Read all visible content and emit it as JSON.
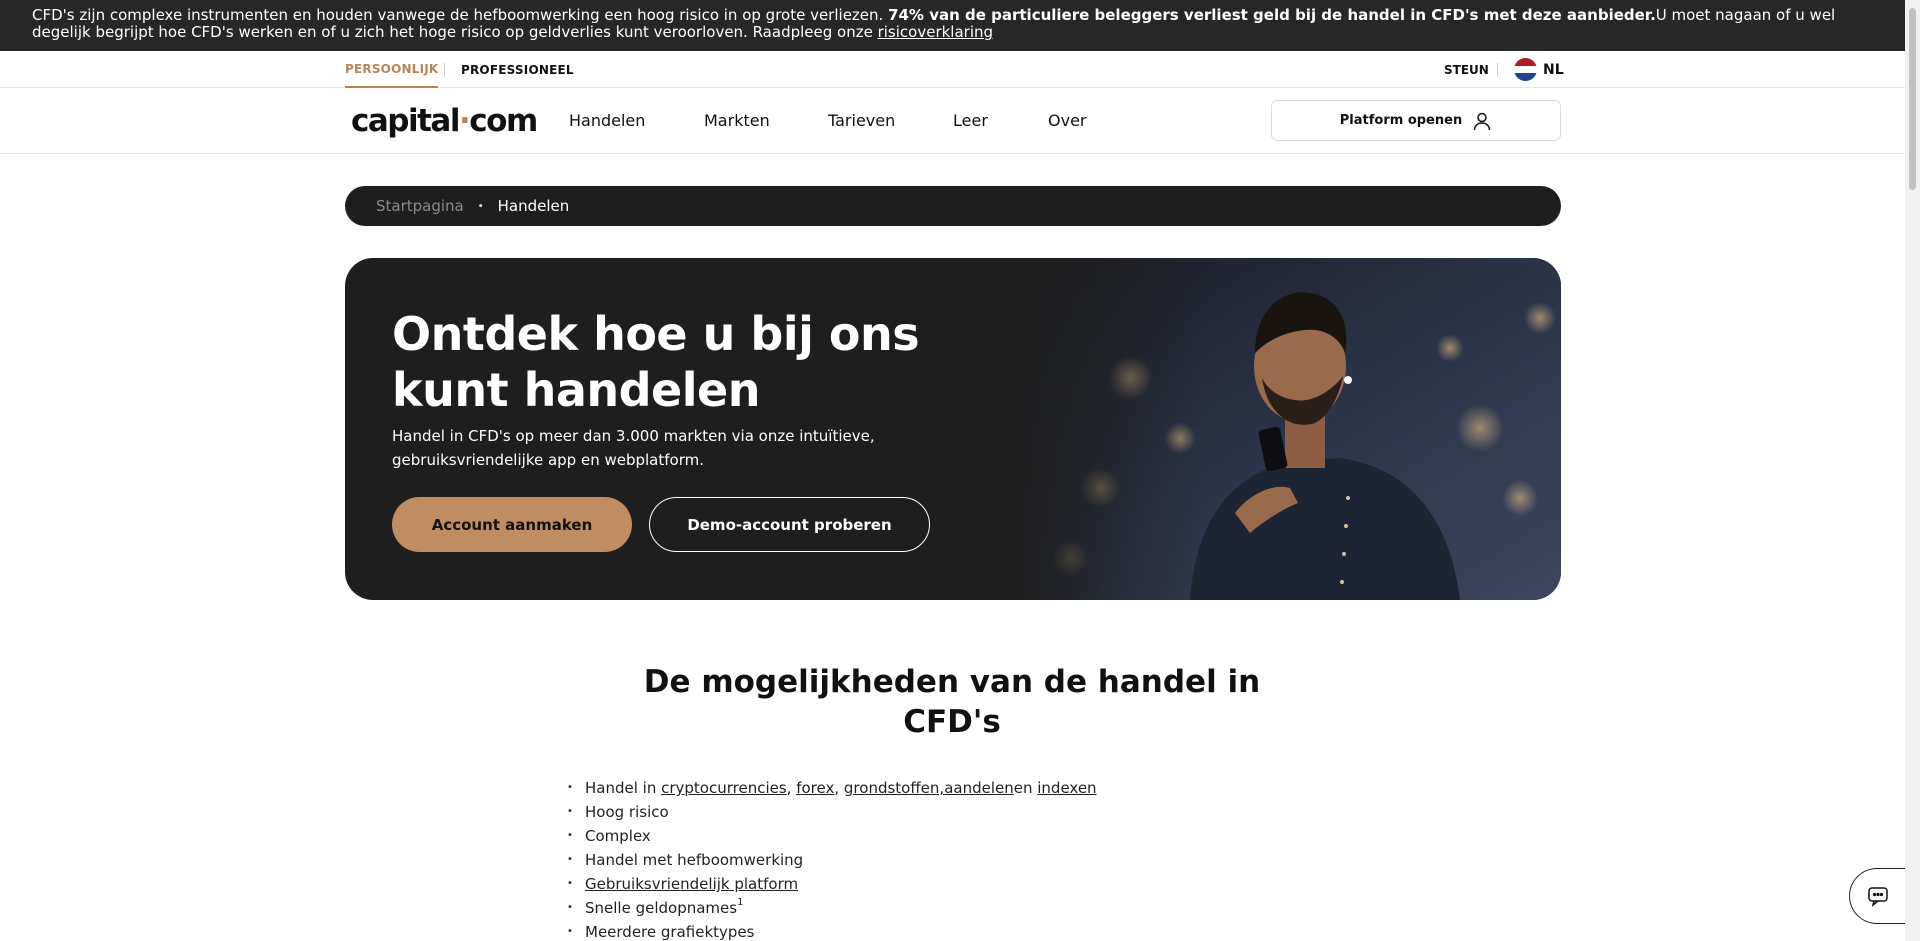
{
  "risk_banner": {
    "text_start": "CFD's zijn complexe instrumenten en houden vanwege de hefboomwerking een hoog risico in op grote verliezen. ",
    "text_bold": "74% van de particuliere beleggers verliest geld bij de handel in CFD's met deze aanbieder.",
    "text_end": "U moet nagaan of u wel degelijk begrijpt hoe CFD's werken en of u zich het hoge risico op geldverlies kunt veroorloven. Raadpleeg onze ",
    "link": "risicoverklaring"
  },
  "segments": {
    "personal": "PERSOONLIJK",
    "professional": "PROFESSIONEEL"
  },
  "support": "STEUN",
  "language": {
    "code": "NL",
    "flag_colors": [
      "#ae1c28",
      "#ffffff",
      "#21468b"
    ]
  },
  "logo": {
    "part1": "capital",
    "dot": "·",
    "part2": "com"
  },
  "nav": {
    "items": [
      "Handelen",
      "Markten",
      "Tarieven",
      "Leer",
      "Over"
    ],
    "platform_button": "Platform openen"
  },
  "breadcrumb": {
    "home": "Startpagina",
    "separator": "•",
    "current": "Handelen"
  },
  "hero": {
    "title": "Ontdek hoe u bij ons kunt handelen",
    "subtitle": "Handel in CFD's op meer dan 3.000 markten via onze intuïtieve, gebruiksvriendelijke app en webplatform.",
    "primary_button": "Account aanmaken",
    "secondary_button": "Demo-account proberen"
  },
  "section": {
    "title": "De mogelijkheden van de handel in CFD's"
  },
  "features": {
    "bullet": "•",
    "trade_prefix": "Handel in ",
    "crypto": "cryptocurrencies",
    "comma1": ", ",
    "forex": "forex",
    "comma2": ", ",
    "commodities": "grondstoffen,",
    "shares": "aandelen",
    "en": "en ",
    "indices": "indexen",
    "high_risk": "Hoog risico",
    "complex": "Complex",
    "leverage": "Handel met hefboomwerking",
    "platform": "Gebruiksvriendelijk platform",
    "withdrawals": "Snelle geldopnames",
    "footnote": "1",
    "chart_types": "Meerdere grafiektypes"
  },
  "colors": {
    "accent": "#b7855a",
    "button_primary": "#c08d62",
    "dark": "#1e1e1e",
    "banner": "#272727"
  },
  "icons": [
    "user-icon",
    "chat-icon",
    "nl-flag-icon"
  ]
}
